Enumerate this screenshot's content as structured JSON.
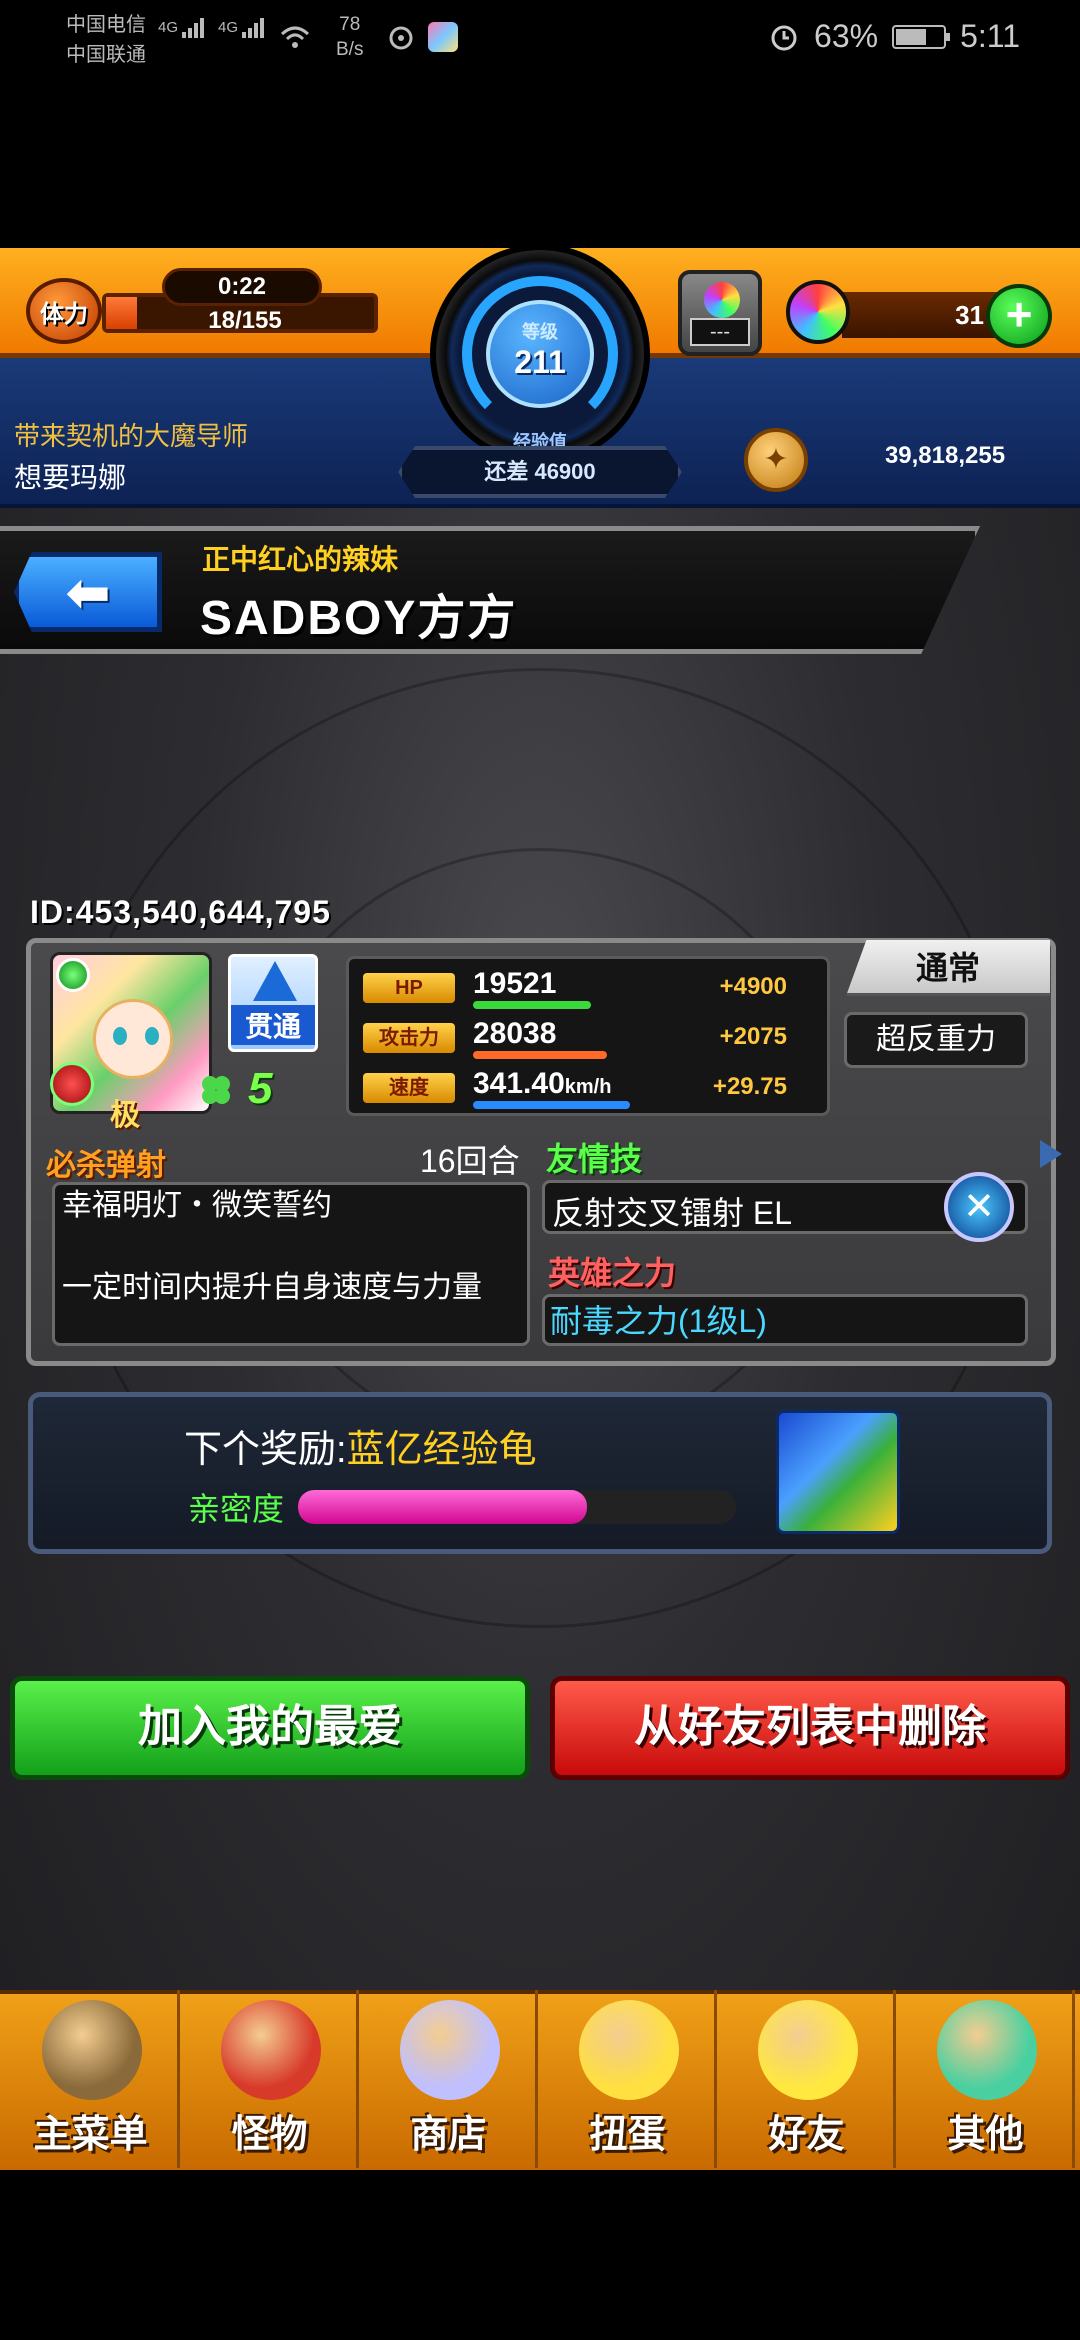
{
  "status_bar": {
    "carrier1": "中国电信",
    "carrier2": "中国联通",
    "signal1": "4G",
    "signal2": "4G",
    "net_speed": "78",
    "net_speed_unit": "B/s",
    "battery": "63%",
    "time": "5:11"
  },
  "hud": {
    "stamina_label": "体力",
    "stamina_timer": "0:22",
    "stamina_value": "18/155",
    "level_label": "等级",
    "level_value": "211",
    "exp_label": "经验值",
    "exp_remaining": "还差 46900",
    "slot_dash": "---",
    "orb_count": "31",
    "player_title": "带来契机的大魔导师",
    "player_name": "想要玛娜",
    "coins": "39,818,255"
  },
  "friend": {
    "title": "正中红心的辣妹",
    "name": "SADBOY方方",
    "id": "ID:453,540,644,795"
  },
  "monster": {
    "evolution": "极",
    "gimmick": "贯通",
    "luck": "5",
    "type": "通常",
    "ability": "超反重力",
    "stats": [
      {
        "label": "HP",
        "value": "19521",
        "unit": "",
        "plus": "+4900",
        "color": "#3ad83a",
        "ratio": 0.37
      },
      {
        "label": "攻击力",
        "value": "28038",
        "unit": "",
        "plus": "+2075",
        "color": "#ff6a2a",
        "ratio": 0.42
      },
      {
        "label": "速度",
        "value": "341.40",
        "unit": "km/h",
        "plus": "+29.75",
        "color": "#2a8aff",
        "ratio": 0.49
      }
    ],
    "strike_shot_label": "必杀弹射",
    "strike_shot_turns": "16回合",
    "strike_shot_name": "幸福明灯・微笑誓约",
    "strike_shot_desc": "一定时间内提升自身速度与力量",
    "friendship_label": "友情技",
    "friendship_name": "反射交叉镭射 EL",
    "hero_label": "英雄之力",
    "hero_name": "耐毒之力(1级L)"
  },
  "reward": {
    "next_label": "下个奖励:",
    "next_value": "蓝亿经验龟",
    "intimacy_label": "亲密度",
    "intimacy_ratio": 0.66
  },
  "actions": {
    "favorite": "加入我的最爱",
    "remove": "从好友列表中删除"
  },
  "nav": [
    {
      "label": "主菜单",
      "icon": "castle-gate-icon",
      "color": "#8a6a3a"
    },
    {
      "label": "怪物",
      "icon": "red-dragon-icon",
      "color": "#d83a2a"
    },
    {
      "label": "商店",
      "icon": "rainbow-orb-icon",
      "color": "#c0c0ff"
    },
    {
      "label": "扭蛋",
      "icon": "egg-icon",
      "color": "#ffe040"
    },
    {
      "label": "好友",
      "icon": "friends-icon",
      "color": "#ffe840"
    },
    {
      "label": "其他",
      "icon": "question-icon",
      "color": "#4ad0a0"
    }
  ]
}
